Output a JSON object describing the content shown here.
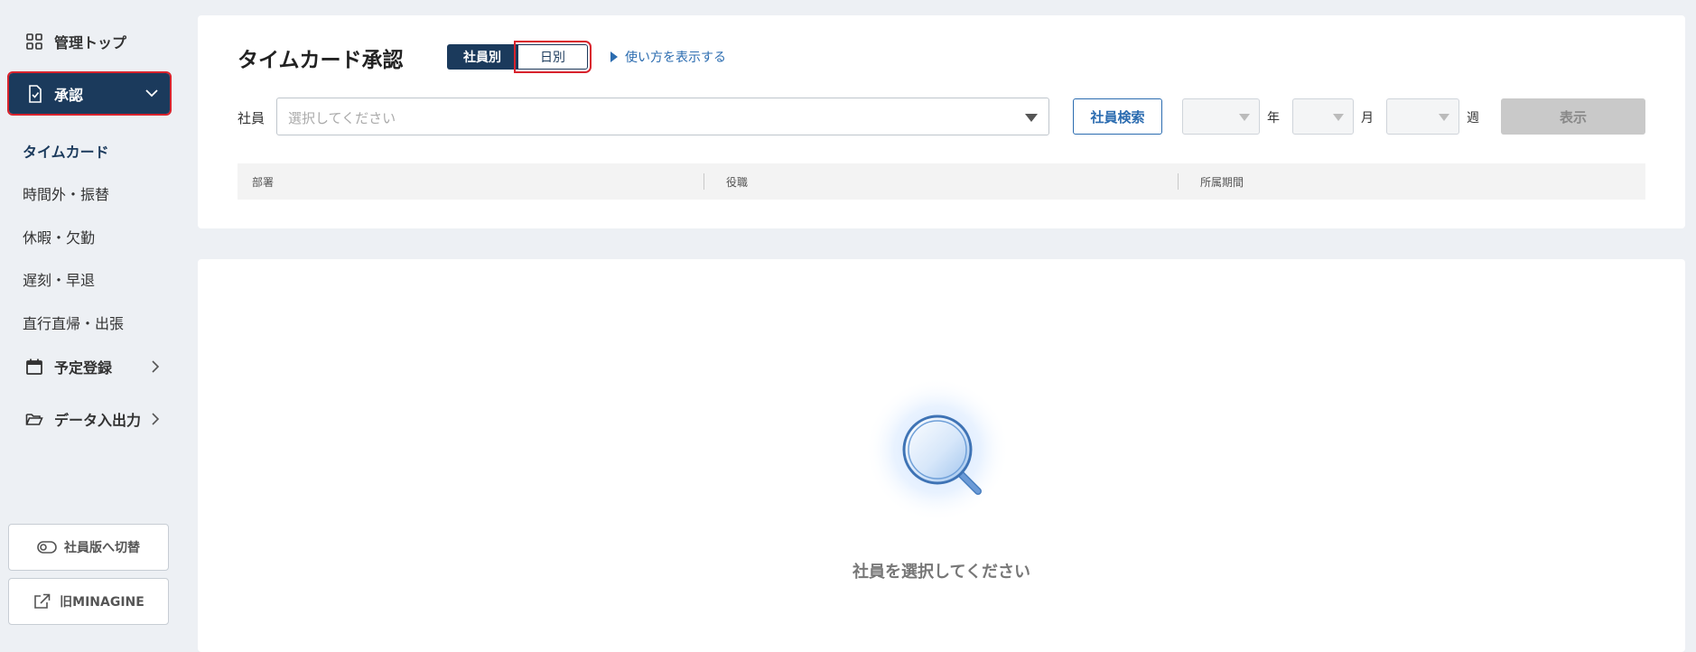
{
  "sidebar": {
    "top_label": "管理トップ",
    "approval_label": "承認",
    "sub_items": [
      {
        "label": "タイムカード"
      },
      {
        "label": "時間外・振替"
      },
      {
        "label": "休暇・欠勤"
      },
      {
        "label": "遅刻・早退"
      },
      {
        "label": "直行直帰・出張"
      }
    ],
    "schedule_label": "予定登録",
    "data_io_label": "データ入出力",
    "switch_label": "社員版へ切替",
    "old_label": "旧MINAGINE"
  },
  "header": {
    "title": "タイムカード承認",
    "toggle_by_employee": "社員別",
    "toggle_by_day": "日別",
    "howto_label": "使い方を表示する"
  },
  "filters": {
    "employee_label": "社員",
    "employee_placeholder": "選択してください",
    "search_button": "社員検索",
    "year_unit": "年",
    "month_unit": "月",
    "week_unit": "週",
    "show_button": "表示"
  },
  "info": {
    "dept_label": "部署",
    "position_label": "役職",
    "period_label": "所属期間"
  },
  "empty_state": {
    "message": "社員を選択してください"
  },
  "colors": {
    "navy": "#1b3a5c",
    "accent_blue": "#2b6cb0",
    "highlight_red": "#d9232d",
    "background": "#edf0f4"
  }
}
